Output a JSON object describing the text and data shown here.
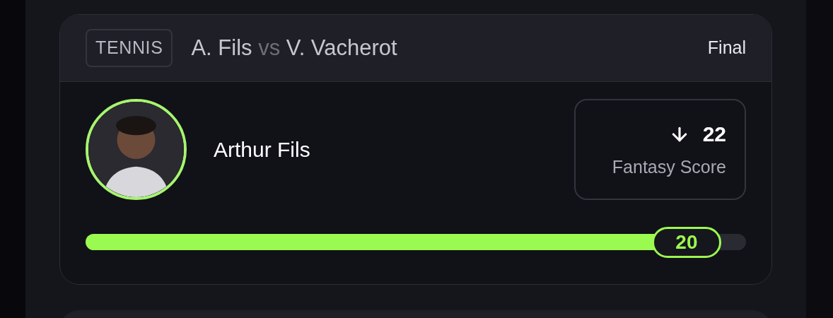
{
  "card": {
    "sport": "TENNIS",
    "player_a": "A. Fils",
    "vs": "vs",
    "player_b": "V. Vacherot",
    "status": "Final",
    "player": {
      "name": "Arthur Fils"
    },
    "score": {
      "down": true,
      "value": "22",
      "label": "Fantasy Score"
    },
    "progress": {
      "level": 0.91,
      "label": "20"
    }
  }
}
